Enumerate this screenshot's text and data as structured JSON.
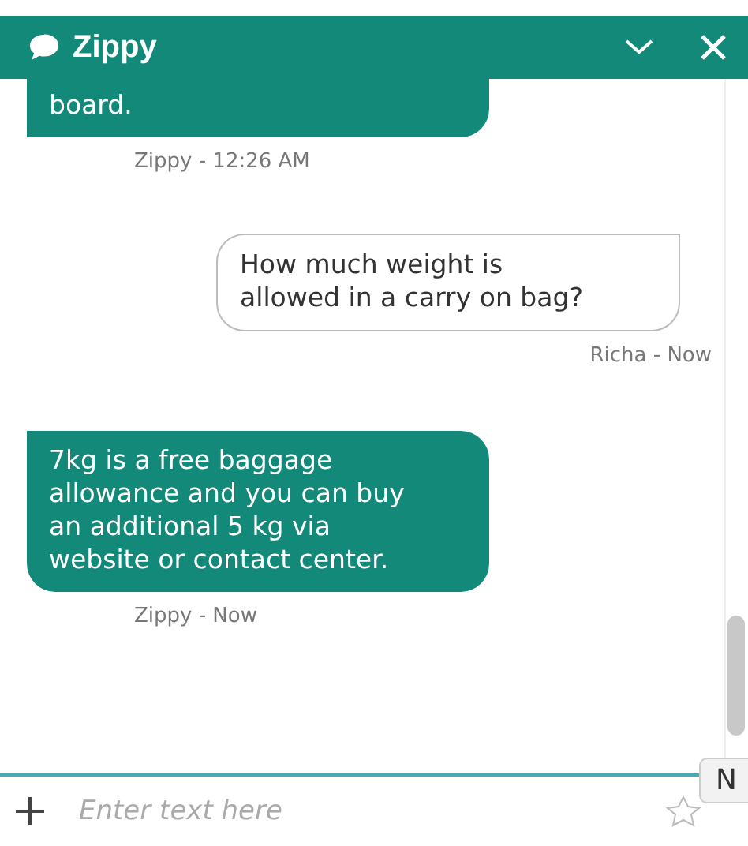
{
  "header": {
    "title": "Zippy"
  },
  "messages": [
    {
      "kind": "bot",
      "text": "board.",
      "meta": "Zippy - 12:26 AM"
    },
    {
      "kind": "user",
      "text": "How much weight is allowed in a carry on bag?",
      "meta": "Richa - Now"
    },
    {
      "kind": "bot",
      "text": "7kg is a free baggage allowance and you can buy an additional 5 kg via website or contact center.",
      "meta": "Zippy - Now"
    }
  ],
  "composer": {
    "placeholder": "Enter text here"
  },
  "tooltip": {
    "text": "N"
  }
}
